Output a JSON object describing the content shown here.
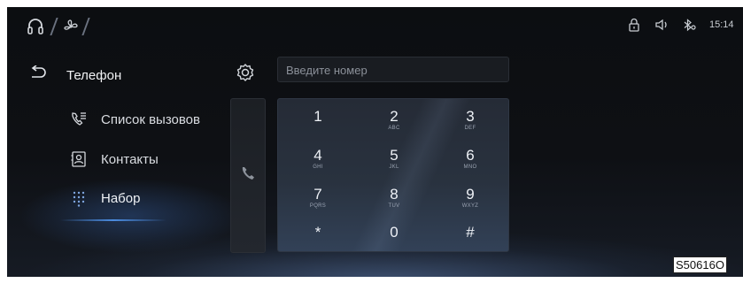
{
  "status_bar": {
    "time": "15:14",
    "icons": [
      "lock-icon",
      "volume-icon",
      "bluetooth-icon"
    ]
  },
  "nav_modes": [
    "headphones-icon",
    "fan-icon"
  ],
  "header": {
    "title": "Телефон",
    "back_icon": "back-arrow-icon",
    "settings_icon": "gear-icon"
  },
  "search": {
    "placeholder": "Введите номер"
  },
  "menu": {
    "items": [
      {
        "label": "Список вызовов",
        "icon": "call-log-icon",
        "active": false
      },
      {
        "label": "Контакты",
        "icon": "contacts-icon",
        "active": false
      },
      {
        "label": "Набор",
        "icon": "dialpad-icon",
        "active": true
      }
    ]
  },
  "call_button_icon": "phone-icon",
  "keypad": {
    "keys": [
      {
        "digit": "1",
        "letters": ""
      },
      {
        "digit": "2",
        "letters": "ABC"
      },
      {
        "digit": "3",
        "letters": "DEF"
      },
      {
        "digit": "4",
        "letters": "GHI"
      },
      {
        "digit": "5",
        "letters": "JKL"
      },
      {
        "digit": "6",
        "letters": "MNO"
      },
      {
        "digit": "7",
        "letters": "PQRS"
      },
      {
        "digit": "8",
        "letters": "TUV"
      },
      {
        "digit": "9",
        "letters": "WXYZ"
      },
      {
        "digit": "*",
        "letters": ""
      },
      {
        "digit": "0",
        "letters": ""
      },
      {
        "digit": "#",
        "letters": ""
      }
    ]
  },
  "colors": {
    "background": "#0e1014",
    "accent": "#4f8fe6",
    "keypad": "#29323f",
    "text": "#e6e8ec"
  },
  "figure_code": "S50616O"
}
